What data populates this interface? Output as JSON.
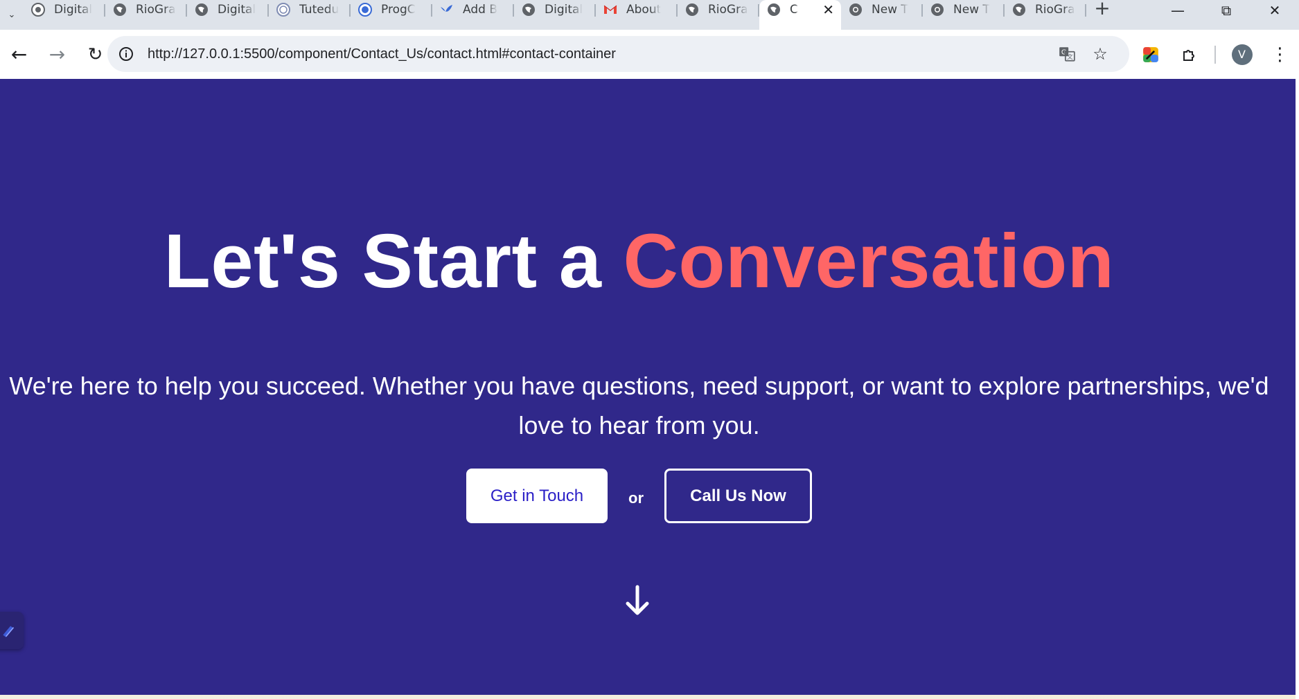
{
  "browser": {
    "tabs": [
      {
        "title": "Digital",
        "icon": "globe-icon"
      },
      {
        "title": "RioGra",
        "icon": "globe-icon"
      },
      {
        "title": "Digital",
        "icon": "globe-icon"
      },
      {
        "title": "Tutedu",
        "icon": "globe-icon"
      },
      {
        "title": "ProgC",
        "icon": "globe-icon"
      },
      {
        "title": "Add B",
        "icon": "bird-icon"
      },
      {
        "title": "Digital",
        "icon": "globe-icon"
      },
      {
        "title": "About",
        "icon": "gmail-icon"
      },
      {
        "title": "RioGra",
        "icon": "globe-icon"
      },
      {
        "title": "C",
        "icon": "globe-icon",
        "active": true
      },
      {
        "title": "New T",
        "icon": "chrome-icon"
      },
      {
        "title": "New T",
        "icon": "chrome-icon"
      },
      {
        "title": "RioGra",
        "icon": "globe-icon"
      }
    ],
    "new_tab_label": "+",
    "close_tab_label": "✕",
    "url": "http://127.0.0.1:5500/component/Contact_Us/contact.html#contact-container",
    "avatar_letter": "V"
  },
  "hero": {
    "title_plain": "Let's Start a ",
    "title_accent": "Conversation",
    "description": "We're here to help you succeed. Whether you have questions, need support, or want to explore partnerships, we'd love to hear from you.",
    "primary_button": "Get in Touch",
    "or_text": "or",
    "secondary_button": "Call Us Now"
  },
  "colors": {
    "page_background": "#30288a",
    "accent": "#ff6666",
    "primary_button_text": "#2b20c7"
  }
}
